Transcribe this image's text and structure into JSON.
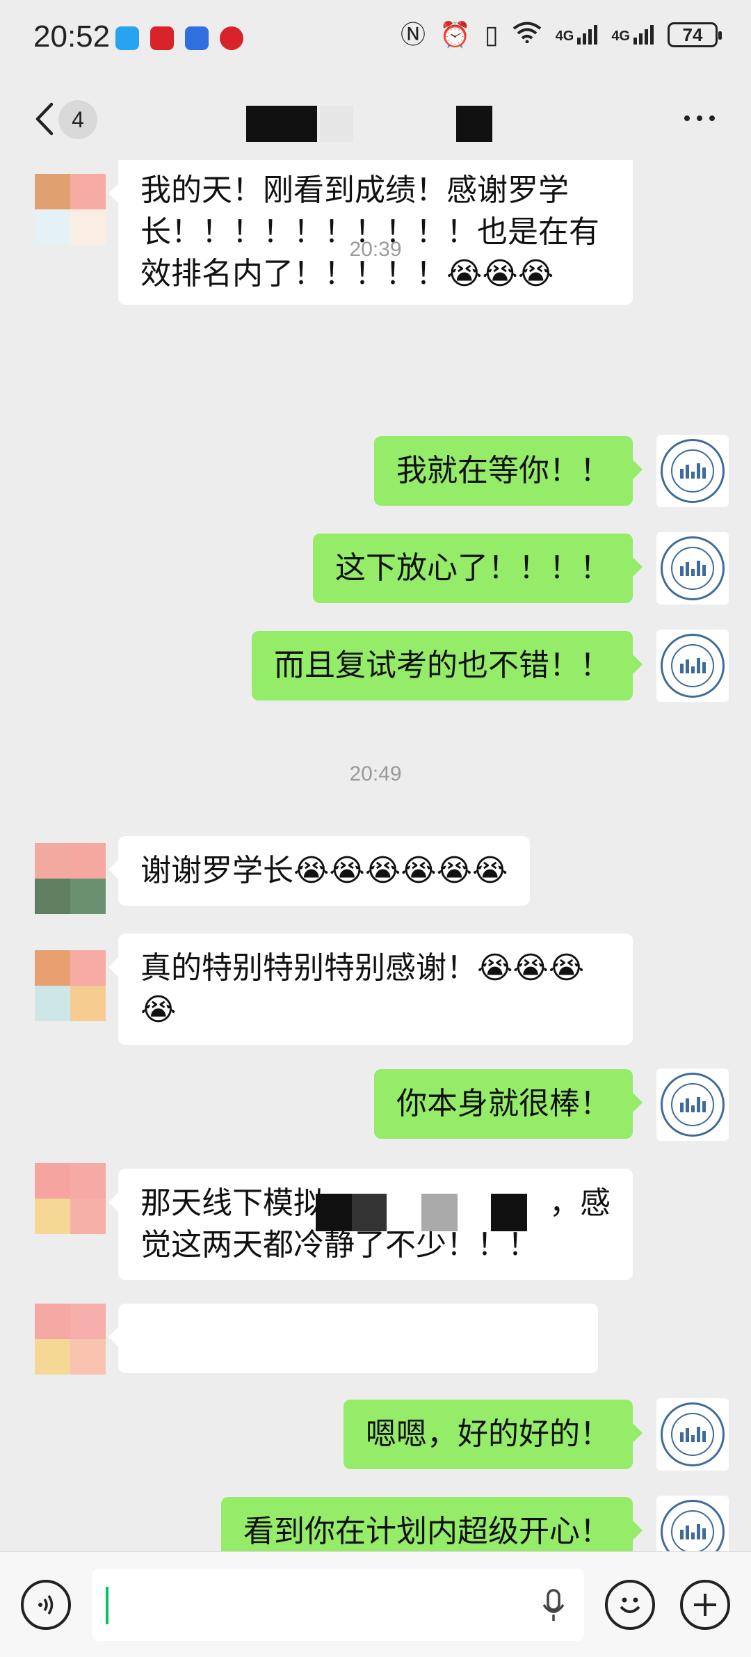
{
  "status_bar": {
    "time": "20:52",
    "network_1": "4G",
    "network_2": "4G",
    "battery": "74"
  },
  "nav": {
    "unread_count": "4"
  },
  "messages": [
    {
      "side": "left",
      "text_line1": "我的天！刚看到成绩！感谢罗学",
      "text_line2": "长！！！！！！！！！！也是在有",
      "text_line3": "效排名内了！！！！！😭😭😭"
    },
    {
      "type": "time",
      "text": "20:39"
    },
    {
      "side": "right",
      "text": "我就在等你！！"
    },
    {
      "side": "right",
      "text": "这下放心了！！！！"
    },
    {
      "side": "right",
      "text": "而且复试考的也不错！！"
    },
    {
      "type": "time",
      "text": "20:49"
    },
    {
      "side": "left",
      "text": "谢谢罗学长😭😭😭😭😭😭"
    },
    {
      "side": "left",
      "text_line1": "真的特别特别特别感谢！😭😭😭",
      "text_line2": "😭"
    },
    {
      "side": "right",
      "text": "你本身就很棒！"
    },
    {
      "side": "left",
      "text_line1": "那天线下模拟",
      "text_line1_end": "，感",
      "text_line2": "觉这两天都冷静了不少！！！"
    },
    {
      "side": "left",
      "text": ""
    },
    {
      "side": "right",
      "text": "嗯嗯，好的好的！"
    },
    {
      "side": "right",
      "text": "看到你在计划内超级开心！"
    }
  ],
  "icons": {
    "voice": "voice-icon",
    "emoji": "emoji-icon",
    "plus": "plus-icon",
    "mic": "mic-icon"
  },
  "colors": {
    "sent_bubble": "#95ec69",
    "received_bubble": "#ffffff",
    "background": "#ededed",
    "cursor": "#07c160"
  }
}
